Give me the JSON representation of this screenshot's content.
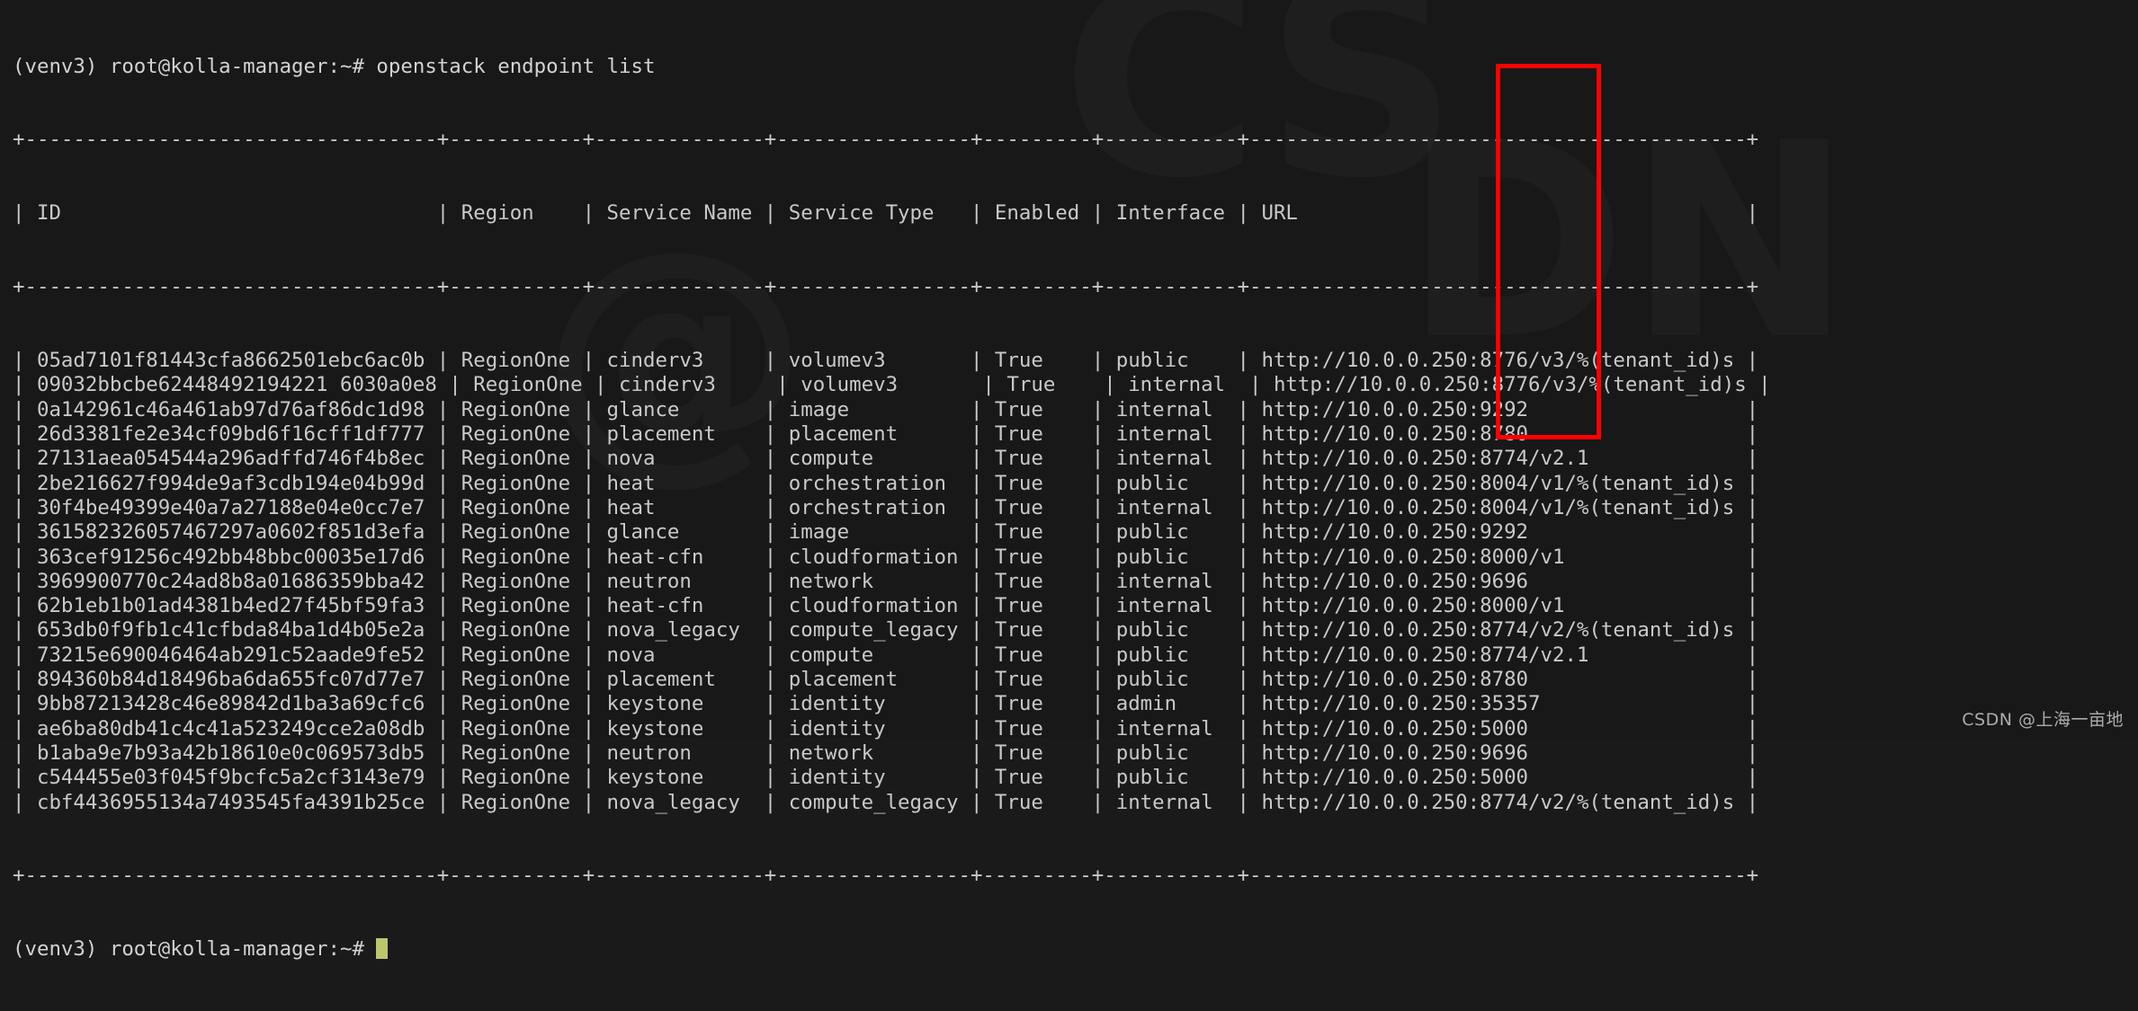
{
  "terminal": {
    "prompt_top": "(venv3) root@kolla-manager:~# ",
    "command": "openstack endpoint list",
    "prompt_bottom": "(venv3) root@kolla-manager:~# ",
    "separator": "+----------------------------------+-----------+--------------+----------------+---------+-----------+-----------------------------------------+",
    "watermark": "CSDN @上海一亩地",
    "cursor_color": "#bdc66a",
    "highlight_color": "#fe0000",
    "background_color": "#181818",
    "text_color": "#c9c9c9",
    "columns": [
      "ID",
      "Region",
      "Service Name",
      "Service Type",
      "Enabled",
      "Interface",
      "URL"
    ],
    "header_row": "| ID                               | Region    | Service Name | Service Type   | Enabled | Interface | URL                                     |",
    "rows": [
      {
        "id": "05ad7101f81443cfa8662501ebc6ac0b",
        "region": "RegionOne",
        "service_name": "cinderv3",
        "service_type": "volumev3",
        "enabled": "True",
        "interface": "public",
        "url": "http://10.0.0.250:8776/v3/%(tenant_id)s"
      },
      {
        "id": "09032bbcbe62448492194221 6030a0e8",
        "region": "RegionOne",
        "service_name": "cinderv3",
        "service_type": "volumev3",
        "enabled": "True",
        "interface": "internal",
        "url": "http://10.0.0.250:8776/v3/%(tenant_id)s"
      },
      {
        "id": "0a142961c46a461ab97d76af86dc1d98",
        "region": "RegionOne",
        "service_name": "glance",
        "service_type": "image",
        "enabled": "True",
        "interface": "internal",
        "url": "http://10.0.0.250:9292"
      },
      {
        "id": "26d3381fe2e34cf09bd6f16cff1df777",
        "region": "RegionOne",
        "service_name": "placement",
        "service_type": "placement",
        "enabled": "True",
        "interface": "internal",
        "url": "http://10.0.0.250:8780"
      },
      {
        "id": "27131aea054544a296adffd746f4b8ec",
        "region": "RegionOne",
        "service_name": "nova",
        "service_type": "compute",
        "enabled": "True",
        "interface": "internal",
        "url": "http://10.0.0.250:8774/v2.1"
      },
      {
        "id": "2be216627f994de9af3cdb194e04b99d",
        "region": "RegionOne",
        "service_name": "heat",
        "service_type": "orchestration",
        "enabled": "True",
        "interface": "public",
        "url": "http://10.0.0.250:8004/v1/%(tenant_id)s"
      },
      {
        "id": "30f4be49399e40a7a27188e04e0cc7e7",
        "region": "RegionOne",
        "service_name": "heat",
        "service_type": "orchestration",
        "enabled": "True",
        "interface": "internal",
        "url": "http://10.0.0.250:8004/v1/%(tenant_id)s"
      },
      {
        "id": "361582326057467297a0602f851d3efa",
        "region": "RegionOne",
        "service_name": "glance",
        "service_type": "image",
        "enabled": "True",
        "interface": "public",
        "url": "http://10.0.0.250:9292"
      },
      {
        "id": "363cef91256c492bb48bbc00035e17d6",
        "region": "RegionOne",
        "service_name": "heat-cfn",
        "service_type": "cloudformation",
        "enabled": "True",
        "interface": "public",
        "url": "http://10.0.0.250:8000/v1"
      },
      {
        "id": "3969900770c24ad8b8a01686359bba42",
        "region": "RegionOne",
        "service_name": "neutron",
        "service_type": "network",
        "enabled": "True",
        "interface": "internal",
        "url": "http://10.0.0.250:9696"
      },
      {
        "id": "62b1eb1b01ad4381b4ed27f45bf59fa3",
        "region": "RegionOne",
        "service_name": "heat-cfn",
        "service_type": "cloudformation",
        "enabled": "True",
        "interface": "internal",
        "url": "http://10.0.0.250:8000/v1"
      },
      {
        "id": "653db0f9fb1c41cfbda84ba1d4b05e2a",
        "region": "RegionOne",
        "service_name": "nova_legacy",
        "service_type": "compute_legacy",
        "enabled": "True",
        "interface": "public",
        "url": "http://10.0.0.250:8774/v2/%(tenant_id)s"
      },
      {
        "id": "73215e690046464ab291c52aade9fe52",
        "region": "RegionOne",
        "service_name": "nova",
        "service_type": "compute",
        "enabled": "True",
        "interface": "public",
        "url": "http://10.0.0.250:8774/v2.1"
      },
      {
        "id": "894360b84d18496ba6da655fc07d77e7",
        "region": "RegionOne",
        "service_name": "placement",
        "service_type": "placement",
        "enabled": "True",
        "interface": "public",
        "url": "http://10.0.0.250:8780"
      },
      {
        "id": "9bb87213428c46e89842d1ba3a69cfc6",
        "region": "RegionOne",
        "service_name": "keystone",
        "service_type": "identity",
        "enabled": "True",
        "interface": "admin",
        "url": "http://10.0.0.250:35357"
      },
      {
        "id": "ae6ba80db41c4c41a523249cce2a08db",
        "region": "RegionOne",
        "service_name": "keystone",
        "service_type": "identity",
        "enabled": "True",
        "interface": "internal",
        "url": "http://10.0.0.250:5000"
      },
      {
        "id": "b1aba9e7b93a42b18610e0c069573db5",
        "region": "RegionOne",
        "service_name": "neutron",
        "service_type": "network",
        "enabled": "True",
        "interface": "public",
        "url": "http://10.0.0.250:9696"
      },
      {
        "id": "c544455e03f045f9bcfc5a2cf3143e79",
        "region": "RegionOne",
        "service_name": "keystone",
        "service_type": "identity",
        "enabled": "True",
        "interface": "public",
        "url": "http://10.0.0.250:5000"
      },
      {
        "id": "cbf4436955134a7493545fa4391b25ce",
        "region": "RegionOne",
        "service_name": "nova_legacy",
        "service_type": "compute_legacy",
        "enabled": "True",
        "interface": "internal",
        "url": "http://10.0.0.250:8774/v2/%(tenant_id)s"
      }
    ],
    "highlighted_value": "10.0.0.250"
  }
}
